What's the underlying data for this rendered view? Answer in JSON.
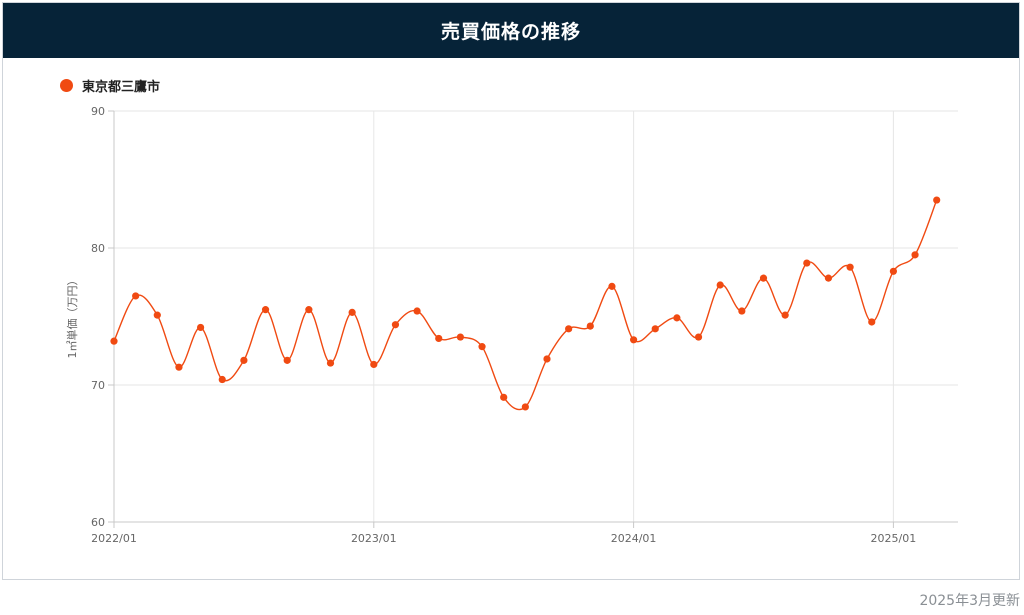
{
  "header": {
    "title": "売買価格の推移"
  },
  "footer": {
    "updated": "2025年3月更新"
  },
  "colors": {
    "header_bg": "#062338",
    "series": "#f04a12",
    "grid": "#e6e6e6"
  },
  "chart_data": {
    "type": "line",
    "ylabel": "1㎡単価（万円）",
    "ylim": [
      60,
      90
    ],
    "yticks": [
      "60",
      "70",
      "80",
      "90"
    ],
    "x_start": "2022/01",
    "x_end": "2025/03",
    "xticks": [
      "2022/01",
      "2023/01",
      "2024/01",
      "2025/01"
    ],
    "grid": true,
    "legend_position": "top-left",
    "series": [
      {
        "name": "東京都三鷹市",
        "x": [
          "2022/01",
          "2022/02",
          "2022/03",
          "2022/04",
          "2022/05",
          "2022/06",
          "2022/07",
          "2022/08",
          "2022/09",
          "2022/10",
          "2022/11",
          "2022/12",
          "2023/01",
          "2023/02",
          "2023/03",
          "2023/04",
          "2023/05",
          "2023/06",
          "2023/07",
          "2023/08",
          "2023/09",
          "2023/10",
          "2023/11",
          "2023/12",
          "2024/01",
          "2024/02",
          "2024/03",
          "2024/04",
          "2024/05",
          "2024/06",
          "2024/07",
          "2024/08",
          "2024/09",
          "2024/10",
          "2024/11",
          "2024/12",
          "2025/01",
          "2025/02",
          "2025/03"
        ],
        "values": [
          73.2,
          76.5,
          75.1,
          71.3,
          74.2,
          70.4,
          71.8,
          75.5,
          71.8,
          75.5,
          71.6,
          75.3,
          71.5,
          74.4,
          75.4,
          73.4,
          73.5,
          72.8,
          69.1,
          68.4,
          71.9,
          74.1,
          74.3,
          77.2,
          73.3,
          74.1,
          74.9,
          73.5,
          77.3,
          75.4,
          77.8,
          75.1,
          78.9,
          77.8,
          78.6,
          74.6,
          78.3,
          79.5,
          83.5
        ]
      }
    ]
  }
}
